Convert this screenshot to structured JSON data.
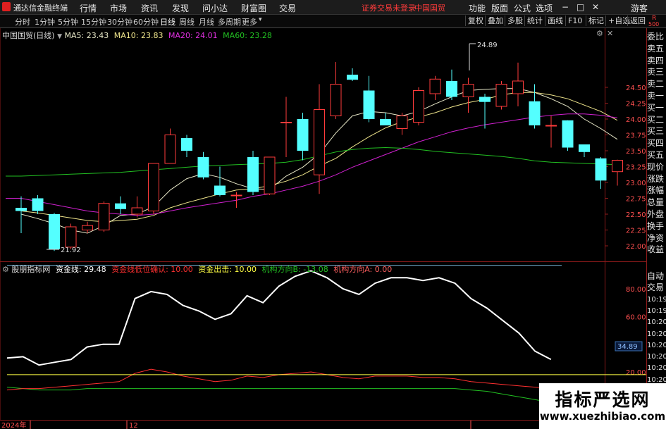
{
  "menubar": {
    "app_name": "通达信金融终端",
    "items": [
      "行情",
      "市场",
      "资讯",
      "发现",
      "问小达",
      "财富圈",
      "交易"
    ],
    "status": "证券交易未登录",
    "stock": "中国国贸",
    "right_items": [
      "功能",
      "版面",
      "公式",
      "选项"
    ],
    "guest": "游客"
  },
  "periods": [
    "分时",
    "1分钟",
    "5分钟",
    "15分钟",
    "30分钟",
    "60分钟",
    "日线",
    "周线",
    "月线",
    "多周期",
    "更多"
  ],
  "active_period": "日线",
  "toolbar": [
    "复权",
    "叠加",
    "多股",
    "统计",
    "画线",
    "F10",
    "标记",
    "+自选",
    "返回"
  ],
  "corner": {
    "r": "R",
    "n": "500"
  },
  "main_chart": {
    "title": "中国国贸(日线)",
    "ma": [
      {
        "name": "MA5",
        "value": "23.43",
        "color": "#e8e8c8"
      },
      {
        "name": "MA10",
        "value": "23.83",
        "color": "#f0e68c"
      },
      {
        "name": "MA20",
        "value": "24.01",
        "color": "#d020d0"
      },
      {
        "name": "MA60",
        "value": "23.28",
        "color": "#22c022"
      }
    ],
    "high_label": "24.89",
    "low_label": "21.92",
    "y_ticks": [
      "24.50",
      "24.25",
      "24.00",
      "23.75",
      "23.50",
      "23.25",
      "23.00",
      "22.75",
      "22.50",
      "22.25",
      "22.00"
    ]
  },
  "chart_data": [
    {
      "type": "candlestick",
      "title": "中国国贸(日线)",
      "ylim": [
        21.9,
        25.0
      ],
      "candles": [
        {
          "o": 22.6,
          "h": 22.78,
          "l": 22.2,
          "c": 22.55
        },
        {
          "o": 22.75,
          "h": 22.8,
          "l": 22.5,
          "c": 22.55
        },
        {
          "o": 22.5,
          "h": 22.52,
          "l": 21.92,
          "c": 21.95
        },
        {
          "o": 21.98,
          "h": 22.35,
          "l": 21.95,
          "c": 22.3
        },
        {
          "o": 22.25,
          "h": 22.38,
          "l": 22.2,
          "c": 22.32
        },
        {
          "o": 22.25,
          "h": 22.7,
          "l": 22.22,
          "c": 22.67
        },
        {
          "o": 22.67,
          "h": 22.78,
          "l": 22.5,
          "c": 22.58
        },
        {
          "o": 22.5,
          "h": 22.78,
          "l": 22.45,
          "c": 22.6
        },
        {
          "o": 22.55,
          "h": 23.3,
          "l": 22.5,
          "c": 23.3
        },
        {
          "o": 23.3,
          "h": 23.85,
          "l": 23.3,
          "c": 23.75
        },
        {
          "o": 23.7,
          "h": 23.75,
          "l": 23.4,
          "c": 23.5
        },
        {
          "o": 23.4,
          "h": 23.48,
          "l": 23.05,
          "c": 23.08
        },
        {
          "o": 22.95,
          "h": 23.25,
          "l": 22.78,
          "c": 22.8
        },
        {
          "o": 22.8,
          "h": 22.85,
          "l": 22.6,
          "c": 22.8
        },
        {
          "o": 23.4,
          "h": 23.5,
          "l": 22.8,
          "c": 22.85
        },
        {
          "o": 22.82,
          "h": 23.4,
          "l": 22.8,
          "c": 23.4
        },
        {
          "o": 23.95,
          "h": 24.35,
          "l": 23.4,
          "c": 23.95
        },
        {
          "o": 24.0,
          "h": 24.1,
          "l": 23.35,
          "c": 23.5
        },
        {
          "o": 23.12,
          "h": 24.55,
          "l": 22.82,
          "c": 24.15
        },
        {
          "o": 24.05,
          "h": 24.9,
          "l": 24.0,
          "c": 24.55
        },
        {
          "o": 24.7,
          "h": 24.8,
          "l": 24.6,
          "c": 24.62
        },
        {
          "o": 24.45,
          "h": 24.68,
          "l": 23.95,
          "c": 24.0
        },
        {
          "o": 24.0,
          "h": 24.1,
          "l": 23.9,
          "c": 23.9
        },
        {
          "o": 23.85,
          "h": 24.1,
          "l": 23.75,
          "c": 24.05
        },
        {
          "o": 23.95,
          "h": 24.5,
          "l": 23.9,
          "c": 24.45
        },
        {
          "o": 24.4,
          "h": 24.68,
          "l": 24.3,
          "c": 24.63
        },
        {
          "o": 24.6,
          "h": 24.78,
          "l": 24.3,
          "c": 24.35
        },
        {
          "o": 24.35,
          "h": 24.65,
          "l": 24.1,
          "c": 24.55
        },
        {
          "o": 24.35,
          "h": 24.4,
          "l": 23.85,
          "c": 24.27
        },
        {
          "o": 24.2,
          "h": 24.6,
          "l": 24.15,
          "c": 24.55
        },
        {
          "o": 24.4,
          "h": 24.89,
          "l": 24.2,
          "c": 24.6
        },
        {
          "o": 24.28,
          "h": 24.55,
          "l": 23.85,
          "c": 23.9
        },
        {
          "o": 23.9,
          "h": 24.05,
          "l": 23.55,
          "c": 23.9
        },
        {
          "o": 23.98,
          "h": 23.98,
          "l": 23.5,
          "c": 23.55
        },
        {
          "o": 23.6,
          "h": 23.6,
          "l": 23.4,
          "c": 23.48
        },
        {
          "o": 23.38,
          "h": 23.4,
          "l": 22.9,
          "c": 23.03
        },
        {
          "o": 23.17,
          "h": 23.36,
          "l": 22.95,
          "c": 23.35
        }
      ],
      "series": [
        {
          "name": "MA5",
          "values": [
            22.5,
            22.43,
            22.35,
            22.25,
            22.2,
            22.32,
            22.48,
            22.5,
            22.62,
            22.88,
            23.06,
            23.14,
            23.08,
            22.98,
            22.9,
            22.89,
            23.1,
            23.24,
            23.45,
            23.78,
            24.05,
            24.12,
            24.1,
            24.05,
            24.12,
            24.24,
            24.35,
            24.45,
            24.47,
            24.48,
            24.48,
            24.42,
            24.32,
            24.2,
            24.0,
            23.85,
            23.68
          ]
        },
        {
          "name": "MA10",
          "values": [
            22.55,
            22.52,
            22.48,
            22.44,
            22.4,
            22.38,
            22.4,
            22.42,
            22.48,
            22.6,
            22.68,
            22.75,
            22.82,
            22.88,
            22.9,
            22.95,
            23.02,
            23.12,
            23.26,
            23.38,
            23.56,
            23.72,
            23.86,
            23.96,
            24.03,
            24.1,
            24.19,
            24.26,
            24.31,
            24.38,
            24.42,
            24.42,
            24.38,
            24.32,
            24.22,
            24.12,
            23.98
          ]
        },
        {
          "name": "MA20",
          "values": [
            22.75,
            22.7,
            22.65,
            22.6,
            22.55,
            22.52,
            22.5,
            22.48,
            22.5,
            22.55,
            22.6,
            22.64,
            22.68,
            22.72,
            22.78,
            22.82,
            22.88,
            22.94,
            23.02,
            23.12,
            23.24,
            23.34,
            23.44,
            23.54,
            23.64,
            23.72,
            23.8,
            23.86,
            23.91,
            23.95,
            23.99,
            24.03,
            24.06,
            24.08,
            24.08,
            24.06,
            24.02
          ]
        },
        {
          "name": "MA60",
          "values": [
            23.1,
            23.11,
            23.12,
            23.13,
            23.14,
            23.15,
            23.16,
            23.18,
            23.2,
            23.22,
            23.24,
            23.26,
            23.27,
            23.28,
            23.29,
            23.3,
            23.32,
            23.36,
            23.42,
            23.48,
            23.52,
            23.54,
            23.55,
            23.54,
            23.52,
            23.49,
            23.47,
            23.45,
            23.43,
            23.41,
            23.38,
            23.34,
            23.32,
            23.31,
            23.3,
            23.29,
            23.28
          ]
        }
      ]
    },
    {
      "type": "line",
      "title": "股朋指标网",
      "ylim": [
        0,
        100
      ],
      "y_ticks": [
        "80.00",
        "60.00",
        "20.00"
      ],
      "series": [
        {
          "name": "资金线",
          "value": "29.48",
          "color": "#ffffff",
          "values": [
            30,
            31,
            25,
            27,
            29,
            38,
            40,
            40,
            73,
            78,
            76,
            68,
            64,
            58,
            62,
            75,
            70,
            82,
            89,
            93,
            88,
            80,
            76,
            84,
            88,
            88,
            86,
            88,
            84,
            73,
            66,
            57,
            48,
            35,
            29
          ]
        },
        {
          "name": "资金线低位确认",
          "value": "10.00",
          "color": "#ff3030",
          "values": [
            7,
            8,
            8,
            9,
            10,
            11,
            12,
            13,
            19,
            22,
            20,
            17,
            15,
            13,
            14,
            17,
            16,
            18,
            19,
            20,
            18,
            16,
            15,
            17,
            17,
            17,
            16,
            16,
            15,
            13,
            12,
            11,
            10,
            9,
            8
          ]
        },
        {
          "name": "资金出击",
          "value": "10.00",
          "color": "#ffff44",
          "values": [
            18,
            18,
            18,
            18,
            18,
            18,
            18,
            18,
            18,
            18,
            18,
            18,
            18,
            18,
            18,
            18,
            18,
            18,
            18,
            18,
            18,
            18,
            18,
            18,
            18,
            18,
            18,
            18,
            18,
            18,
            18,
            18,
            18,
            18,
            18
          ]
        },
        {
          "name": "机构方向B",
          "value": "-13.08",
          "color": "#22c022",
          "values": [
            9,
            8,
            7,
            7,
            7,
            8,
            8,
            8,
            8,
            8,
            8,
            8,
            8,
            8,
            8,
            8,
            8,
            8,
            8,
            8,
            8,
            8,
            8,
            8,
            8,
            8,
            8,
            8,
            8,
            7,
            6,
            4,
            2,
            0,
            -2
          ]
        },
        {
          "name": "机构方向A",
          "value": "0.00",
          "color": "#ff6060",
          "values": []
        }
      ],
      "level_line": 97,
      "current_label": "34.89"
    }
  ],
  "x_axis": {
    "labels": [
      "2024年",
      "12"
    ]
  },
  "right_panel": {
    "items": [
      "委比",
      "卖五",
      "卖四",
      "卖三",
      "卖二",
      "卖一",
      "买一",
      "买二",
      "买三",
      "买四",
      "买五",
      "现价",
      "涨跌",
      "涨幅",
      "总量",
      "外盘",
      "换手",
      "净资",
      "收益"
    ],
    "lower_items": [
      "自动",
      "交易",
      "10:19",
      "10:19",
      "10:20",
      "10:20",
      "10:20",
      "10:20",
      "10:20",
      "10:20",
      "10:20",
      "10:20",
      "10:20"
    ]
  },
  "watermark": {
    "title": "指标严选网",
    "url": "www.xuezhibiao.com"
  }
}
